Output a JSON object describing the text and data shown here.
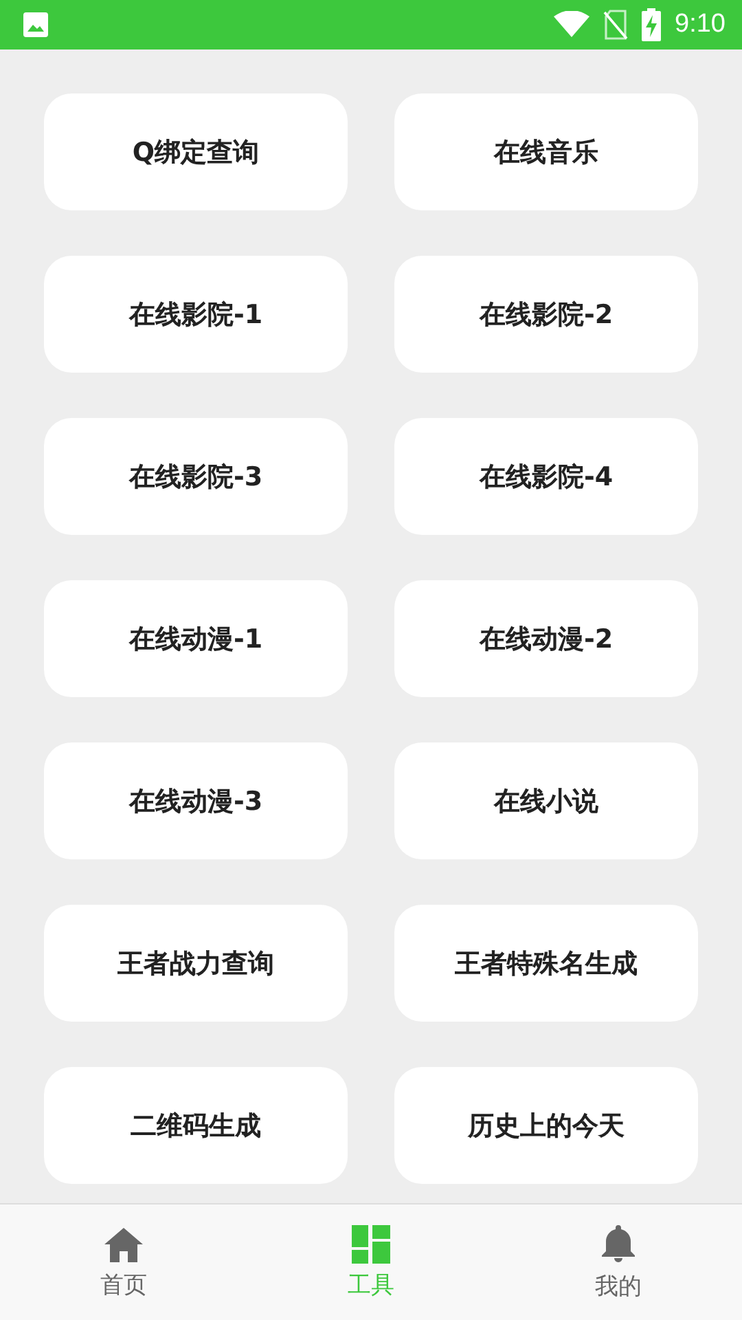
{
  "status_bar": {
    "time": "9:10"
  },
  "tools": [
    {
      "label": "Q绑定查询"
    },
    {
      "label": "在线音乐"
    },
    {
      "label": "在线影院-1"
    },
    {
      "label": "在线影院-2"
    },
    {
      "label": "在线影院-3"
    },
    {
      "label": "在线影院-4"
    },
    {
      "label": "在线动漫-1"
    },
    {
      "label": "在线动漫-2"
    },
    {
      "label": "在线动漫-3"
    },
    {
      "label": "在线小说"
    },
    {
      "label": "王者战力查询"
    },
    {
      "label": "王者特殊名生成"
    },
    {
      "label": "二维码生成"
    },
    {
      "label": "历史上的今天"
    }
  ],
  "bottom_nav": [
    {
      "kind": "home",
      "label": "首页",
      "selected": false
    },
    {
      "kind": "tools",
      "label": "工具",
      "selected": true
    },
    {
      "kind": "bell",
      "label": "我的",
      "selected": false
    }
  ]
}
